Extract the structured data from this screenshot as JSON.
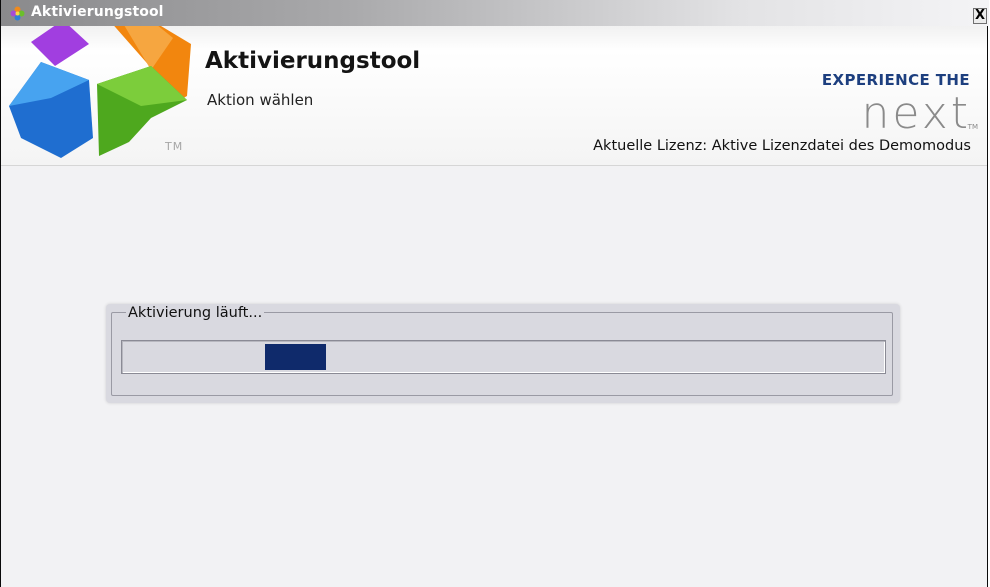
{
  "window": {
    "title": "Aktivierungstool",
    "close_label": "X"
  },
  "header": {
    "title": "Aktivierungstool",
    "subtitle": "Aktion wählen",
    "logo_trademark": "TM",
    "brand_tagline": "EXPERIENCE THE",
    "brand_word": "next",
    "brand_trademark": "TM",
    "license_status": "Aktuelle Lizenz: Aktive Lizenzdatei des Demomodus"
  },
  "progress": {
    "label": "Aktivierung läuft...",
    "mode": "indeterminate",
    "chunk_start_fraction": 0.188,
    "chunk_end_fraction": 0.268
  },
  "colors": {
    "brand_blue": "#1d3f7f",
    "progress_fill": "#0f2a6b",
    "panel_background": "#d9d9e0"
  },
  "icons": {
    "app_icon": "flower-logo-icon",
    "close": "close-icon"
  }
}
